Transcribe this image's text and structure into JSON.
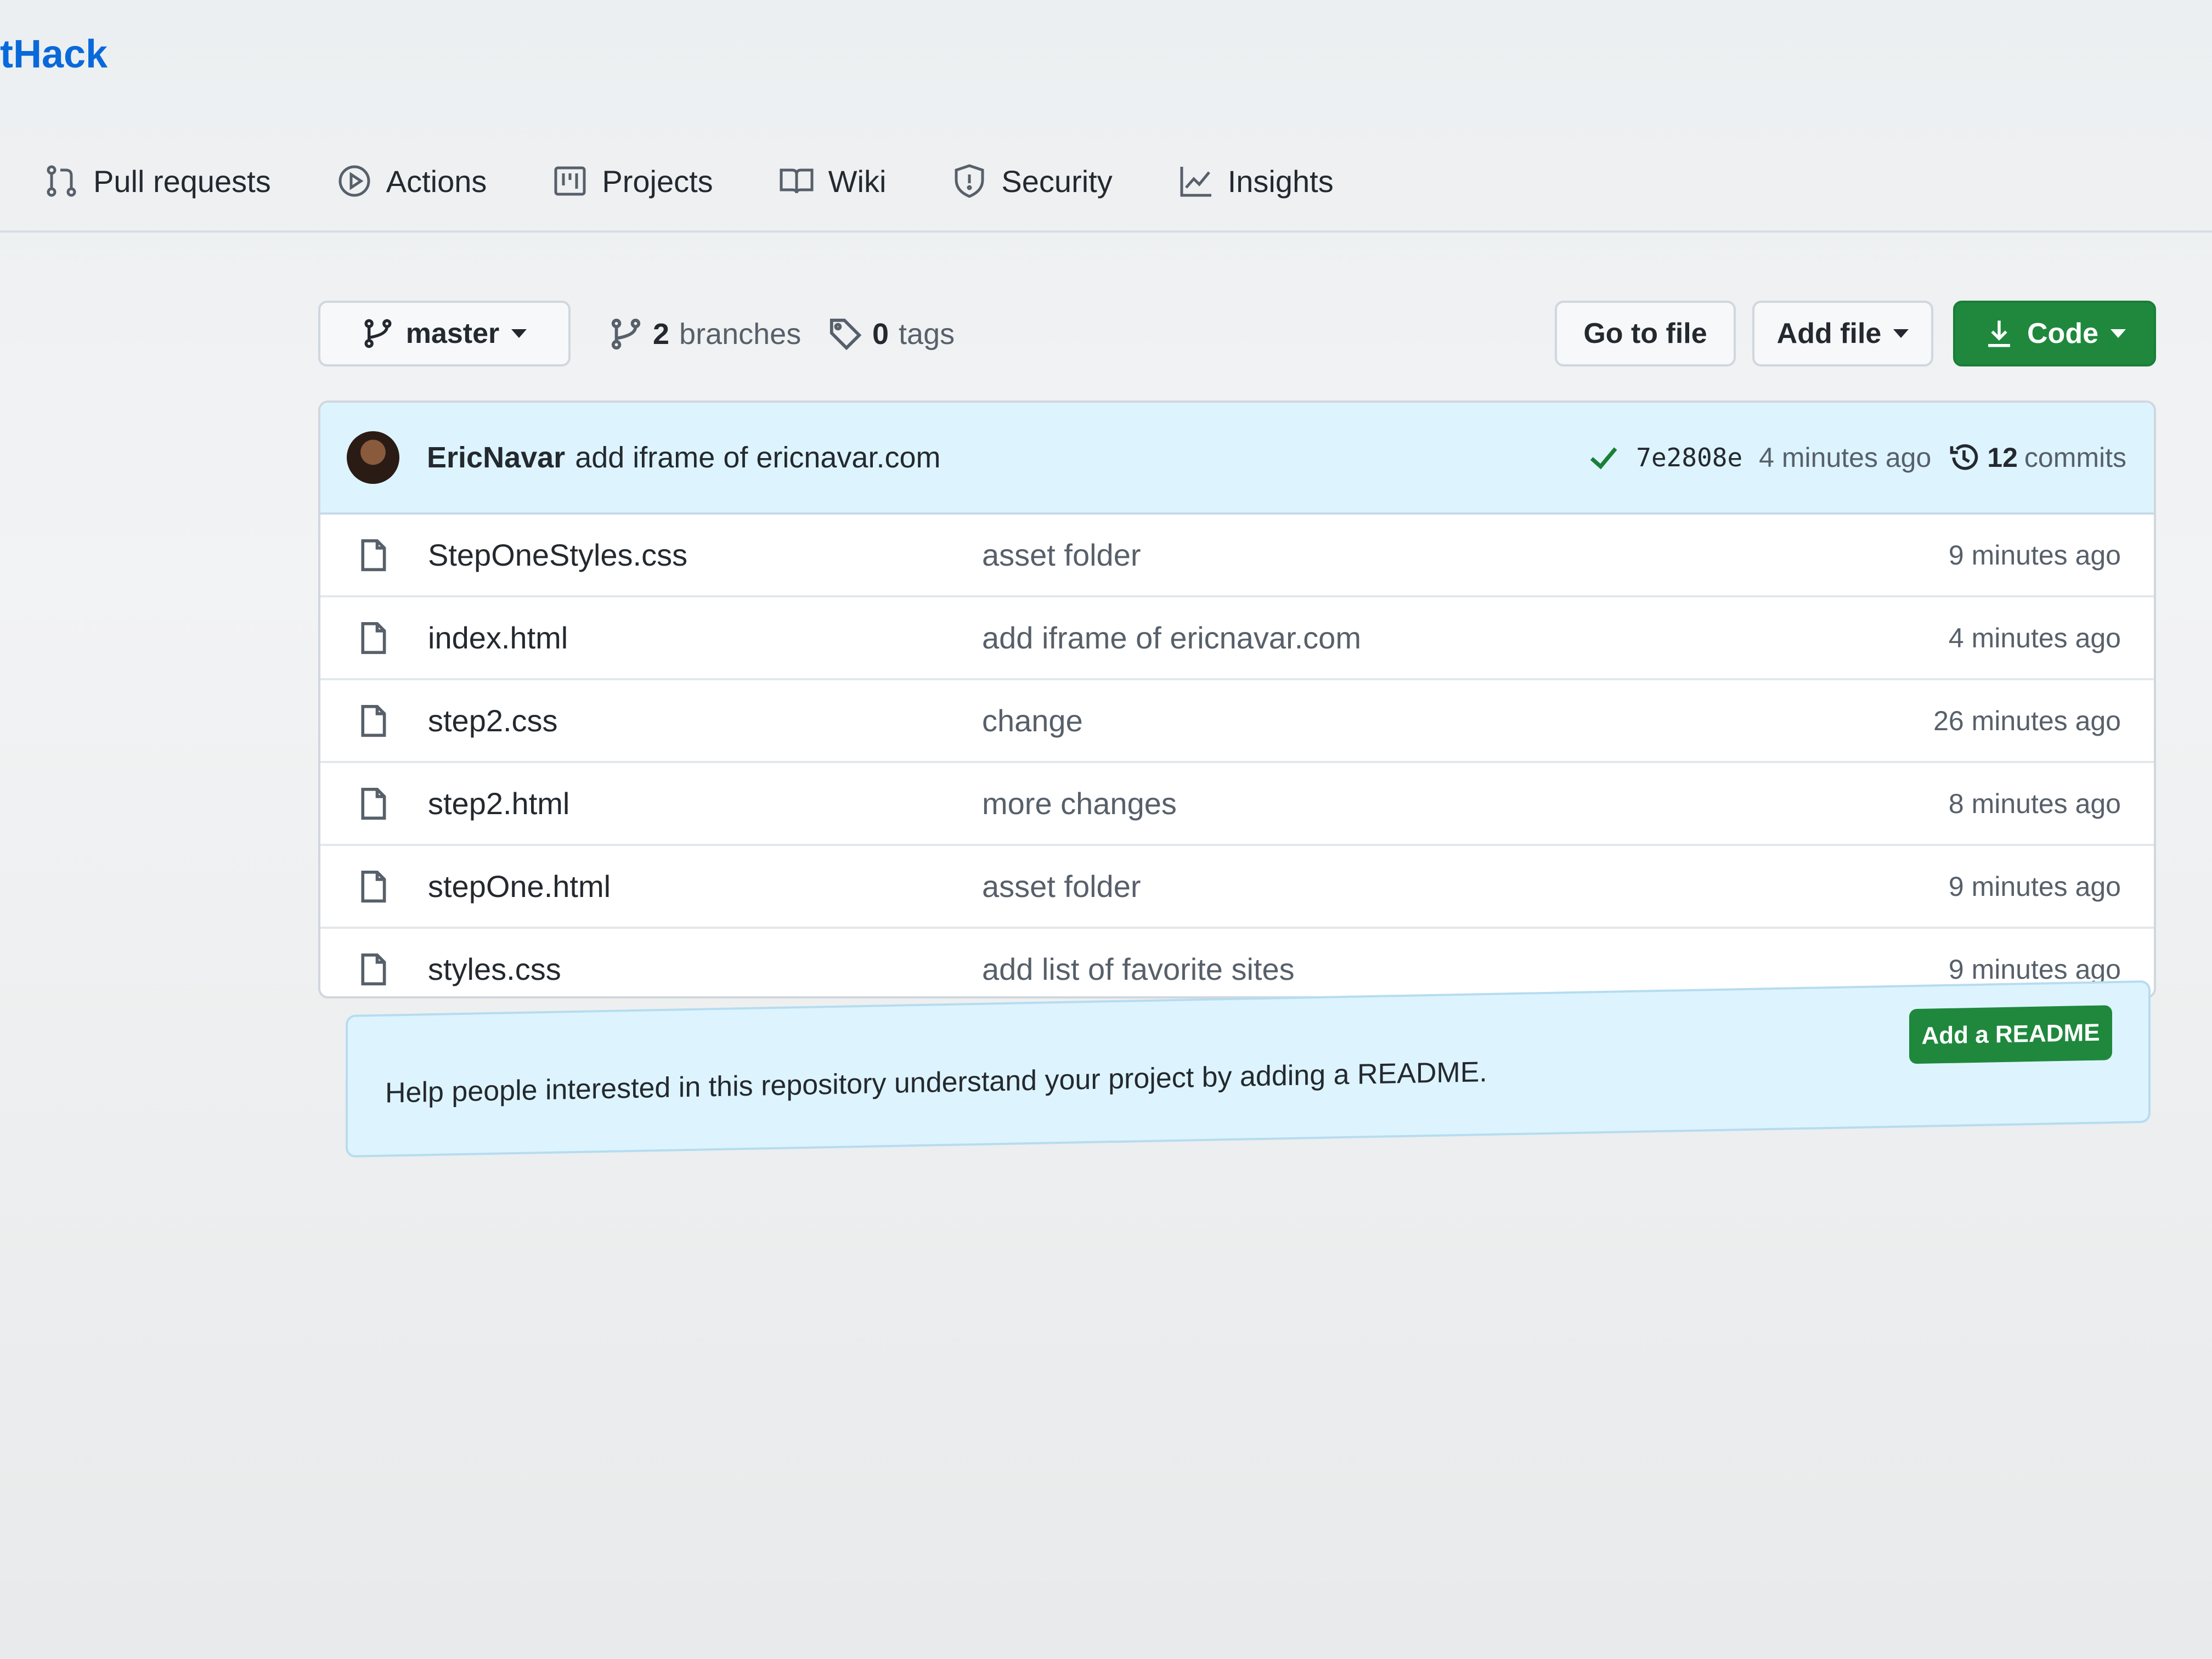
{
  "repo": {
    "title": "tHack"
  },
  "nav": {
    "items": [
      {
        "label": "Pull requests",
        "icon": "pull-request-icon"
      },
      {
        "label": "Actions",
        "icon": "play-icon"
      },
      {
        "label": "Projects",
        "icon": "project-board-icon"
      },
      {
        "label": "Wiki",
        "icon": "book-icon"
      },
      {
        "label": "Security",
        "icon": "shield-icon"
      },
      {
        "label": "Insights",
        "icon": "graph-icon"
      }
    ]
  },
  "toolbar": {
    "branch": "master",
    "branches_count": "2",
    "branches_label": "branches",
    "tags_count": "0",
    "tags_label": "tags",
    "go_to_file": "Go to file",
    "add_file": "Add file",
    "code": "Code"
  },
  "latest_commit": {
    "author": "EricNavar",
    "message": "add iframe of ericnavar.com",
    "sha": "7e2808e",
    "time": "4 minutes ago",
    "commits_count": "12",
    "commits_label": "commits"
  },
  "files": [
    {
      "name": "StepOneStyles.css",
      "message": "asset folder",
      "age": "9 minutes ago"
    },
    {
      "name": "index.html",
      "message": "add iframe of ericnavar.com",
      "age": "4 minutes ago"
    },
    {
      "name": "step2.css",
      "message": "change",
      "age": "26 minutes ago"
    },
    {
      "name": "step2.html",
      "message": "more changes",
      "age": "8 minutes ago"
    },
    {
      "name": "stepOne.html",
      "message": "asset folder",
      "age": "9 minutes ago"
    },
    {
      "name": "styles.css",
      "message": "add list of favorite sites",
      "age": "9 minutes ago"
    }
  ],
  "readme_banner": {
    "text": "Help people interested in this repository understand your project by adding a README.",
    "button": "Add a README"
  },
  "colors": {
    "accent_green": "#1f883d",
    "link_blue": "#0969da",
    "banner_blue": "#ddf4ff"
  }
}
